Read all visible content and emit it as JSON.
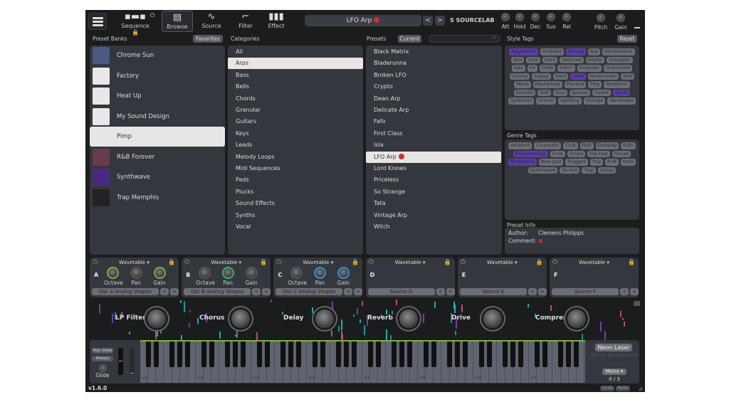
{
  "nav": {
    "items": [
      {
        "label": "Sequence",
        "icon": "sequence-icon"
      },
      {
        "label": "Browse",
        "icon": "browse-icon"
      },
      {
        "label": "Source",
        "icon": "sine-wave-icon"
      },
      {
        "label": "Filter",
        "icon": "filter-curve-icon"
      },
      {
        "label": "Effect",
        "icon": "bars-icon"
      }
    ],
    "active": "Browse"
  },
  "preset": {
    "name": "LFO Arp",
    "prev": "<",
    "next": ">"
  },
  "brand": "SOURCELAB",
  "envelope": [
    "Att",
    "Hold",
    "Dec",
    "Sus",
    "Rel"
  ],
  "master": [
    "Pitch",
    "Gain"
  ],
  "headers": {
    "banks": "Preset Banks",
    "favorites": "Favorites",
    "categories": "Categories",
    "presets": "Presets",
    "current": "Current",
    "search_placeholder": "",
    "style_tags": "Style Tags",
    "reset": "Reset",
    "genre_tags": "Genre Tags",
    "preset_info": "Preset Info"
  },
  "banks": [
    {
      "name": "Chrome Sun"
    },
    {
      "name": "Factory"
    },
    {
      "name": "Heat Up"
    },
    {
      "name": "My Sound Design"
    },
    {
      "name": "Pimp",
      "selected": true
    },
    {
      "name": "R&B Forever"
    },
    {
      "name": "Synthwave"
    },
    {
      "name": "Trap Memphis"
    }
  ],
  "categories": [
    "All",
    "Arps",
    "Bass",
    "Bells",
    "Chords",
    "Granular",
    "Guitars",
    "Keys",
    "Leads",
    "Melody Loops",
    "Midi Sequences",
    "Pads",
    "Plucks",
    "Sound Effects",
    "Synths",
    "Vocal"
  ],
  "selected_category": "Arps",
  "presets": [
    "Black Matrix",
    "Bladerunna",
    "Broken LFO",
    "Crypto",
    "Dean Arp",
    "Delicate Arp",
    "Fafo",
    "First Class",
    "Isla",
    "LFO Arp",
    "Lord Knows",
    "Priceless",
    "So Strange",
    "Tata",
    "Vintage Arp",
    "Witch"
  ],
  "selected_preset": "LFO Arp",
  "style_tags": [
    "Aggressive",
    "Ambient",
    "Analog",
    "Arp",
    "Atmospheric",
    "Bell",
    "Chill",
    "Dark",
    "Detuned",
    "Digital",
    "Energetic",
    "Epic",
    "Fx",
    "Glide",
    "Glitch",
    "Granular",
    "Granulized",
    "Groovy",
    "Happy",
    "Hard",
    "Lead",
    "Melancholic",
    "Midi",
    "Mono",
    "Mysterious",
    "Plucked",
    "Poly",
    "Rhythmic",
    "Smooth",
    "Soft",
    "Soul",
    "Spacey",
    "Sweet",
    "Synth",
    "Synthetic",
    "Unison",
    "Uplifting",
    "Vintage",
    "Wavetable"
  ],
  "style_selected": [
    "Aggressive",
    "Analog",
    "Lead",
    "Synth"
  ],
  "genre_tags": [
    "Ambient",
    "Cinematic",
    "Club",
    "Drill",
    "Dubstep",
    "Edm",
    "Experimental",
    "Funk",
    "Grime",
    "Hip Hop",
    "House",
    "Multigenre",
    "New Jazz",
    "Pluggnb",
    "Pop",
    "RnB",
    "Rock",
    "Synthwave",
    "Techno",
    "Trap",
    "Urban"
  ],
  "genre_selected": [
    "Experimental",
    "Multigenre"
  ],
  "info": {
    "author_label": "Author:",
    "author": "Clemens Philipps",
    "comment_label": "Comment:"
  },
  "oscillators": [
    {
      "letter": "A",
      "type": "Wavetable",
      "enabled": true,
      "knobs": [
        "Octave",
        "Pan",
        "Gain"
      ],
      "source": "Osc A Analog Shapes"
    },
    {
      "letter": "B",
      "type": "Wavetable",
      "enabled": true,
      "knobs": [
        "Octave",
        "Pan",
        "Gain"
      ],
      "source": "Osc B Analog Shapes"
    },
    {
      "letter": "C",
      "type": "Wavetable",
      "enabled": true,
      "knobs": [
        "Octave",
        "Pan",
        "Gain"
      ],
      "source": "Osc C Analog Shapes"
    },
    {
      "letter": "D",
      "type": "Wavetable",
      "enabled": false,
      "knobs": [],
      "source": "Source D"
    },
    {
      "letter": "E",
      "type": "Wavetable",
      "enabled": false,
      "knobs": [],
      "source": "Source E"
    },
    {
      "letter": "F",
      "type": "Wavetable",
      "enabled": false,
      "knobs": [],
      "source": "Source F"
    }
  ],
  "macros": [
    "LP Filter",
    "Chorus",
    "Delay",
    "Reverb",
    "Drive",
    "Compress"
  ],
  "keyboard": {
    "poly_glide": "Poly Glide",
    "always": "Always",
    "glide": "Glide",
    "octave_labels": [
      "C0",
      "C1",
      "C2",
      "C3",
      "C4",
      "C5",
      "C6",
      "C7"
    ]
  },
  "macro_bg": {
    "name": "Neon Laser",
    "label": "Macro Background"
  },
  "voice": {
    "mode": "Mono",
    "count": "0 / 3"
  },
  "footer": {
    "version": "v1.6.0",
    "undo": "Undo",
    "redo": "Redo"
  },
  "colors": {
    "accent_green": "#3bd15a",
    "tag_selected": "#5b3fa0",
    "knob_blue": "#3a8fd0"
  }
}
